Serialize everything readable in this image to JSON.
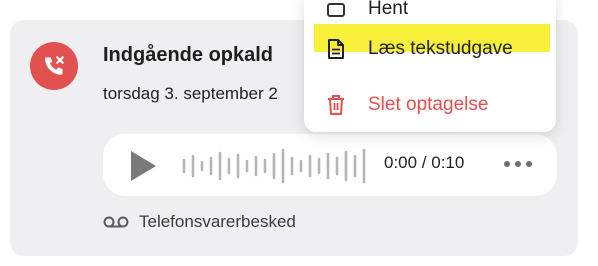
{
  "call": {
    "title": "Indgående opkald",
    "date": "torsdag 3. september 2"
  },
  "player": {
    "time": "0:00 / 0:10"
  },
  "voicemail": {
    "label": "Telefonsvarerbesked"
  },
  "menu": {
    "items": [
      {
        "label": "Hent",
        "icon": "download-icon"
      },
      {
        "label": "Læs tekstudgave",
        "icon": "document-icon",
        "highlighted": true
      },
      {
        "label": "Slet optagelse",
        "icon": "trash-icon",
        "color": "#e0514f"
      }
    ]
  },
  "colors": {
    "card_bg": "#efeff1",
    "avatar_red": "#e0514f",
    "highlight": "#f7ef3a",
    "delete_red": "#e0514f"
  }
}
